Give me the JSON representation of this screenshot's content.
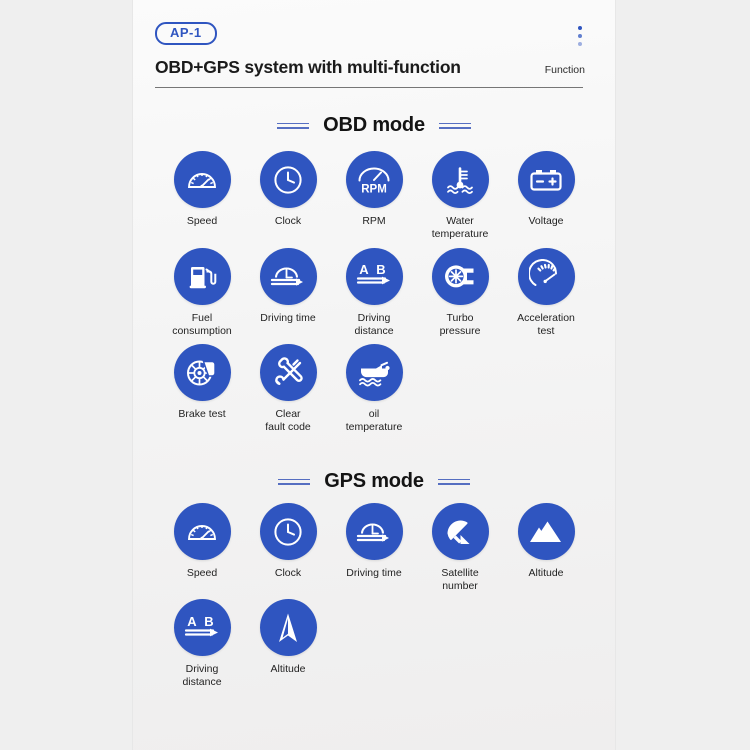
{
  "header": {
    "badge": "AP-1",
    "title": "OBD+GPS system with multi-function",
    "function_label": "Function",
    "menu_icon": "kebab-menu-icon"
  },
  "colors": {
    "accent_blue": "#2f55c0",
    "card_bg": "#f7f7f7",
    "page_bg": "#efefef",
    "title_text": "#1b1b1b"
  },
  "sections": [
    {
      "title": "OBD mode",
      "items": [
        {
          "label": "Speed",
          "icon": "speedometer-icon"
        },
        {
          "label": "Clock",
          "icon": "clock-icon"
        },
        {
          "label": "RPM",
          "icon": "rpm-gauge-icon"
        },
        {
          "label": "Water\ntemperature",
          "icon": "water-temperature-icon"
        },
        {
          "label": "Voltage",
          "icon": "battery-icon"
        },
        {
          "label": "Fuel\nconsumption",
          "icon": "fuel-pump-icon"
        },
        {
          "label": "Driving time",
          "icon": "driving-time-icon"
        },
        {
          "label": "Driving\ndistance",
          "icon": "a-to-b-arrow-icon"
        },
        {
          "label": "Turbo\npressure",
          "icon": "turbocharger-icon"
        },
        {
          "label": "Acceleration\ntest",
          "icon": "acceleration-gauge-icon"
        },
        {
          "label": "Brake test",
          "icon": "brake-disc-icon"
        },
        {
          "label": "Clear\nfault code",
          "icon": "wrench-spanner-icon"
        },
        {
          "label": "oil\ntemperature",
          "icon": "oil-can-icon"
        }
      ]
    },
    {
      "title": "GPS mode",
      "items": [
        {
          "label": "Speed",
          "icon": "speedometer-icon"
        },
        {
          "label": "Clock",
          "icon": "clock-icon"
        },
        {
          "label": "Driving time",
          "icon": "driving-time-icon"
        },
        {
          "label": "Satellite\nnumber",
          "icon": "satellite-dish-icon"
        },
        {
          "label": "Altitude",
          "icon": "mountains-icon"
        },
        {
          "label": "Driving\ndistance",
          "icon": "a-to-b-arrow-icon"
        },
        {
          "label": "Altitude",
          "icon": "navigation-arrow-icon"
        }
      ]
    }
  ]
}
